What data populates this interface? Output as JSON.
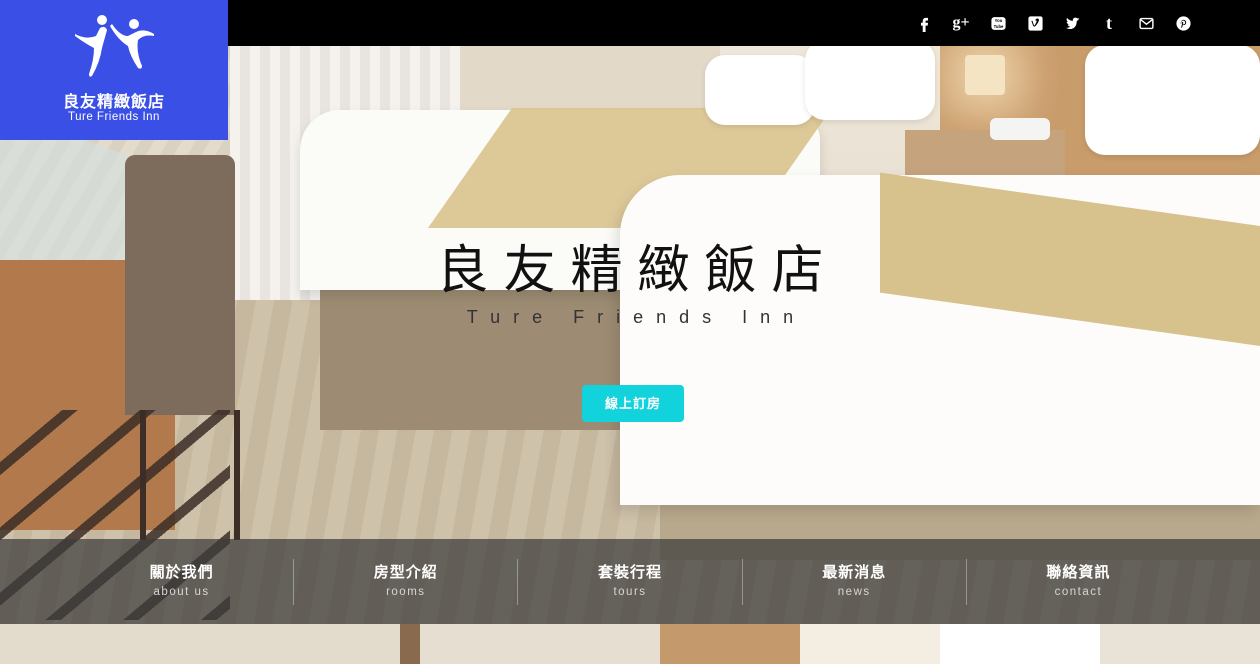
{
  "brand": {
    "name": "良友精緻飯店",
    "name_en": "Ture Friends Inn",
    "color": "#3a4fe6"
  },
  "social_links": [
    {
      "name": "facebook",
      "icon": "facebook-icon"
    },
    {
      "name": "google-plus",
      "icon": "google-plus-icon"
    },
    {
      "name": "youtube",
      "icon": "youtube-icon"
    },
    {
      "name": "vimeo",
      "icon": "vimeo-icon"
    },
    {
      "name": "twitter",
      "icon": "twitter-icon"
    },
    {
      "name": "tumblr",
      "icon": "tumblr-icon"
    },
    {
      "name": "email",
      "icon": "mail-icon"
    },
    {
      "name": "pinterest",
      "icon": "pinterest-icon"
    }
  ],
  "hero": {
    "title": "良友精緻飯店",
    "subtitle": "Ture Friends Inn",
    "cta_label": "線上訂房",
    "cta_color": "#12d2dc"
  },
  "nav": {
    "items": [
      {
        "label": "關於我們",
        "sub": "about us"
      },
      {
        "label": "房型介紹",
        "sub": "rooms"
      },
      {
        "label": "套裝行程",
        "sub": "tours"
      },
      {
        "label": "最新消息",
        "sub": "news"
      },
      {
        "label": "聯絡資訊",
        "sub": "contact"
      }
    ]
  }
}
